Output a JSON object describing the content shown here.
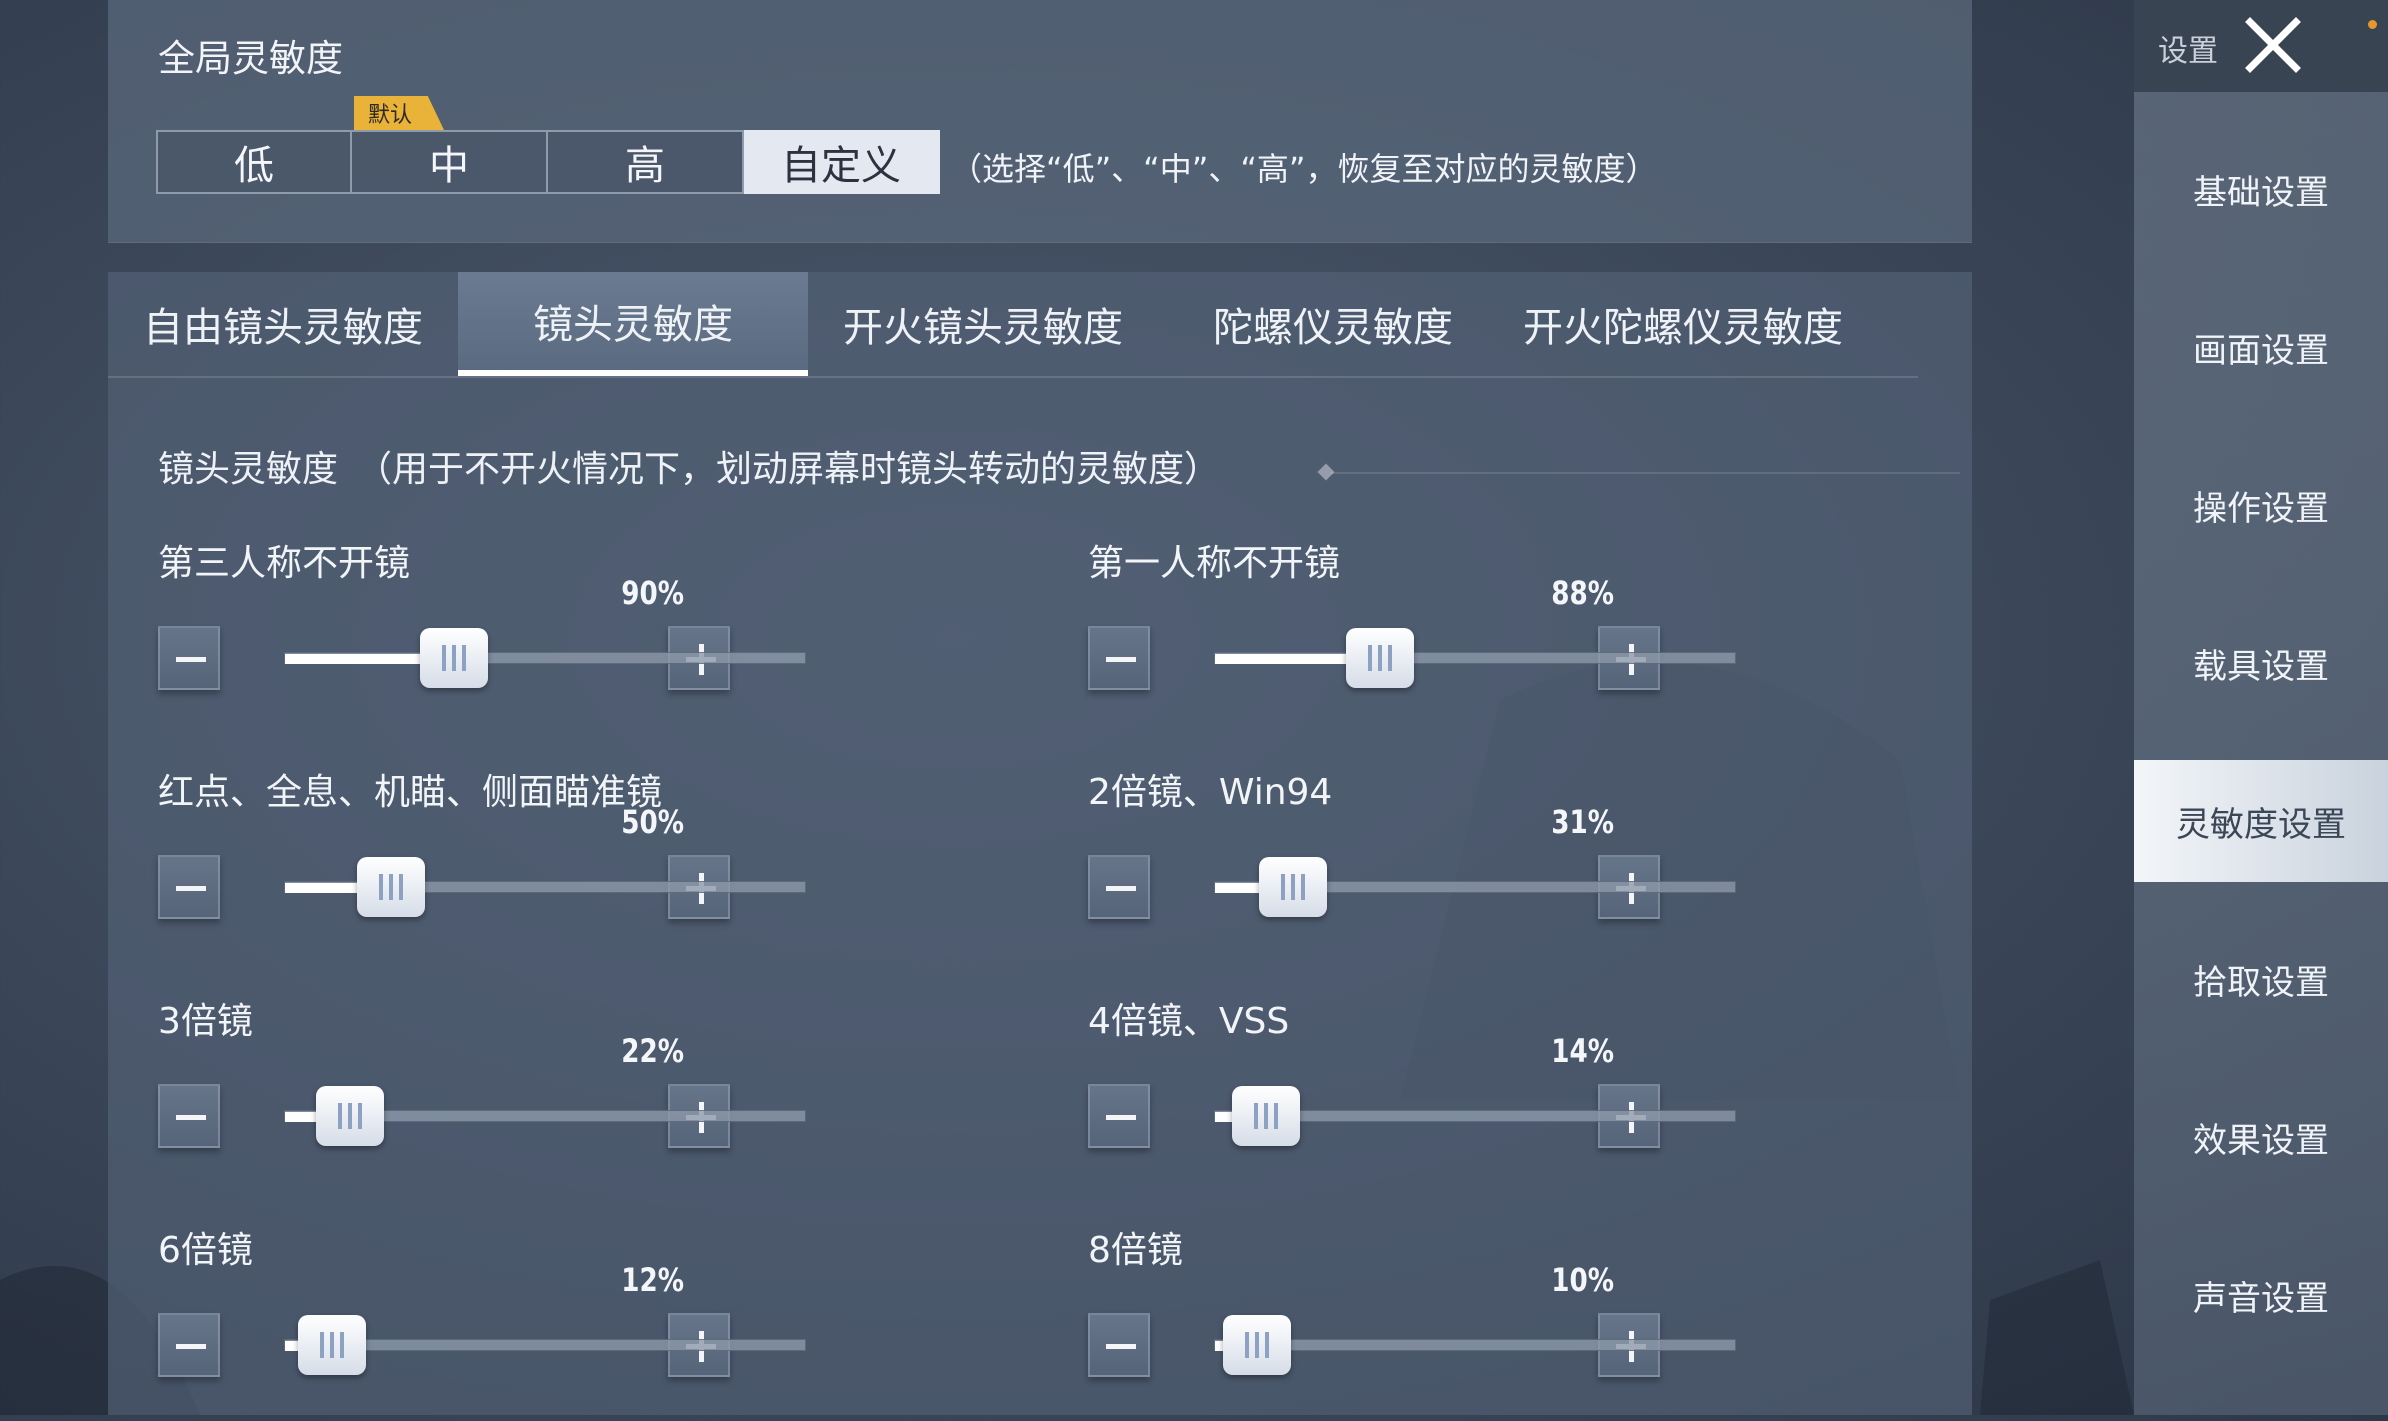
{
  "global": {
    "title": "全局灵敏度",
    "presets": [
      "低",
      "中",
      "高",
      "自定义"
    ],
    "selected_preset": "自定义",
    "default_badge": "默认",
    "hint": "（选择“低”、“中”、“高”，恢复至对应的灵敏度）"
  },
  "tabs": [
    "自由镜头灵敏度",
    "镜头灵敏度",
    "开火镜头灵敏度",
    "陀螺仪灵敏度",
    "开火陀螺仪灵敏度"
  ],
  "active_tab": "镜头灵敏度",
  "section": {
    "header": "镜头灵敏度　（用于不开火情况下，划动屏幕时镜头转动的灵敏度）"
  },
  "sliders": [
    {
      "label": "第三人称不开镜",
      "value_text": "90%",
      "position": 0.3
    },
    {
      "label": "第一人称不开镜",
      "value_text": "88%",
      "position": 0.29
    },
    {
      "label": "红点、全息、机瞄、侧面瞄准镜",
      "value_text": "50%",
      "position": 0.16
    },
    {
      "label": "2倍镜、Win94",
      "value_text": "31%",
      "position": 0.1
    },
    {
      "label": "3倍镜",
      "value_text": "22%",
      "position": 0.07
    },
    {
      "label": "4倍镜、VSS",
      "value_text": "14%",
      "position": 0.04
    },
    {
      "label": "6倍镜",
      "value_text": "12%",
      "position": 0.03
    },
    {
      "label": "8倍镜",
      "value_text": "10%",
      "position": 0.02
    }
  ],
  "sidebar": {
    "title": "设置",
    "items": [
      "基础设置",
      "画面设置",
      "操作设置",
      "载具设置",
      "灵敏度设置",
      "拾取设置",
      "效果设置",
      "声音设置"
    ],
    "active": "灵敏度设置"
  },
  "colors": {
    "badge": "#e9b33a",
    "selected": "#e4e9f1",
    "notification": "#e8962e"
  }
}
